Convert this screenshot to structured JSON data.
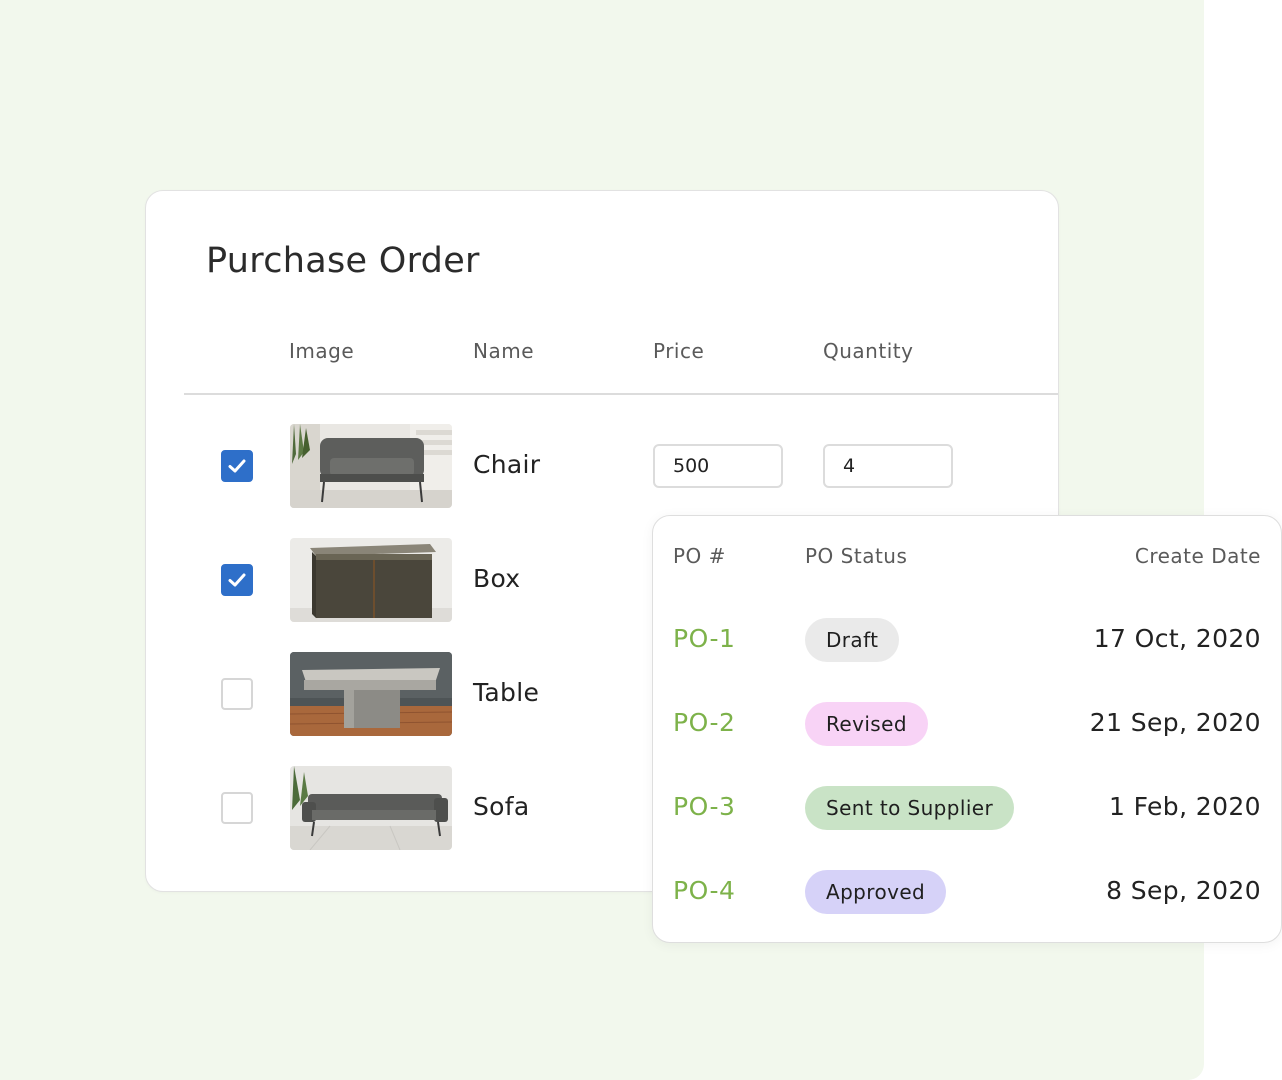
{
  "purchase_order": {
    "title": "Purchase Order",
    "columns": [
      "Image",
      "Name",
      "Price",
      "Quantity"
    ],
    "items": [
      {
        "name": "Chair",
        "checked": true,
        "image": "chair-photo",
        "price": "500",
        "quantity": "4"
      },
      {
        "name": "Box",
        "checked": true,
        "image": "box-photo"
      },
      {
        "name": "Table",
        "checked": false,
        "image": "table-photo"
      },
      {
        "name": "Sofa",
        "checked": false,
        "image": "sofa-photo"
      }
    ]
  },
  "po_status": {
    "columns": [
      "PO #",
      "PO Status",
      "Create Date"
    ],
    "rows": [
      {
        "id": "PO-1",
        "status": "Draft",
        "status_color": "#eaeaea",
        "date": "17 Oct, 2020"
      },
      {
        "id": "PO-2",
        "status": "Revised",
        "status_color": "#f8d3f6",
        "date": "21 Sep, 2020"
      },
      {
        "id": "PO-3",
        "status": "Sent to Supplier",
        "status_color": "#c9e3c6",
        "date": "1 Feb, 2020"
      },
      {
        "id": "PO-4",
        "status": "Approved",
        "status_color": "#d6d2f8",
        "date": "8 Sep, 2020"
      }
    ]
  },
  "colors": {
    "background_panel": "#f2f8ed",
    "checkbox_checked": "#2e6fc9",
    "po_id": "#7db24a"
  }
}
